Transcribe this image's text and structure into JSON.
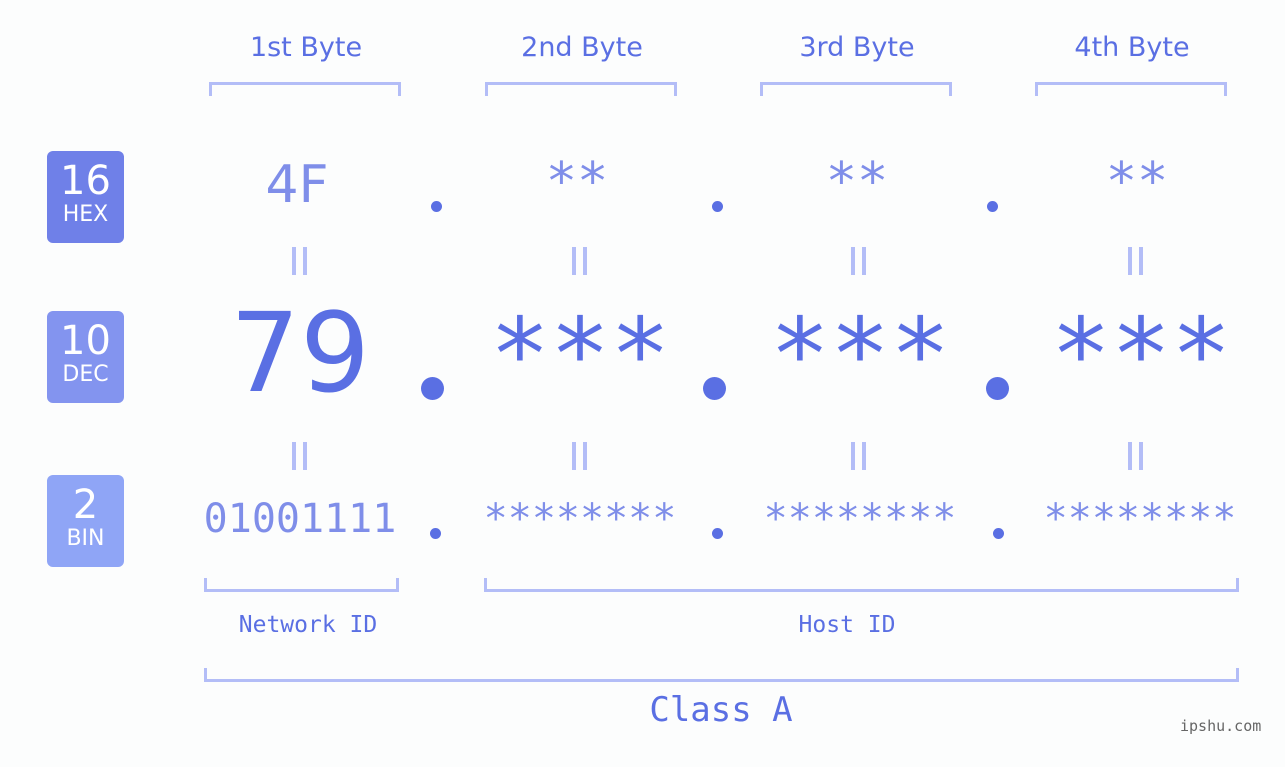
{
  "byte_headers": [
    "1st Byte",
    "2nd Byte",
    "3rd Byte",
    "4th Byte"
  ],
  "badges": {
    "hex": {
      "num": "16",
      "label": "HEX",
      "color": "#6f80e8"
    },
    "dec": {
      "num": "10",
      "label": "DEC",
      "color": "#8394ef"
    },
    "bin": {
      "num": "2",
      "label": "BIN",
      "color": "#8fa5f6"
    }
  },
  "hex": [
    "4F",
    "**",
    "**",
    "**"
  ],
  "dec": [
    "79",
    "***",
    "***",
    "***"
  ],
  "bin": [
    "01001111",
    "********",
    "********",
    "********"
  ],
  "labels": {
    "network_id": "Network ID",
    "host_id": "Host ID",
    "class": "Class A"
  },
  "watermark": "ipshu.com",
  "colors": {
    "accent": "#5a6fe3",
    "light": "#7f8ee9",
    "bracket": "#b3bdf7"
  }
}
